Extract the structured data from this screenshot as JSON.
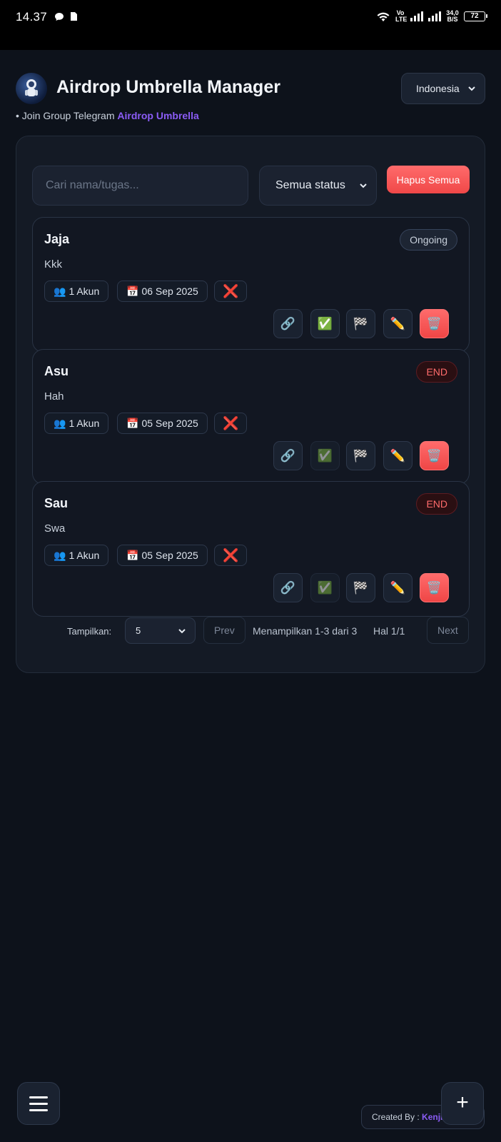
{
  "status_bar": {
    "time": "14.37",
    "volte": "Vo LTE",
    "speed": "34,0 B/S",
    "battery": "72"
  },
  "header": {
    "title": "Airdrop Umbrella Manager",
    "language": "Indonesia",
    "subline_prefix": "• Join Group Telegram ",
    "subline_link": "Airdrop Umbrella"
  },
  "toolbar": {
    "search_placeholder": "Cari nama/tugas...",
    "status_filter": "Semua status",
    "clear_all": "Hapus Semua"
  },
  "cards": [
    {
      "name": "Jaja",
      "desc": "Kkk",
      "status": "Ongoing",
      "accounts": "1 Akun",
      "date": "06 Sep 2025",
      "done": false
    },
    {
      "name": "Asu",
      "desc": "Hah",
      "status": "END",
      "accounts": "1 Akun",
      "date": "05 Sep 2025",
      "done": true
    },
    {
      "name": "Sau",
      "desc": "Swa",
      "status": "END",
      "accounts": "1 Akun",
      "date": "05 Sep 2025",
      "done": true
    }
  ],
  "icons": {
    "accounts": "👥",
    "date": "📅",
    "not_done": "❌",
    "link": "🔗",
    "check": "✅",
    "finish": "🏁",
    "edit": "✏️",
    "delete": "🗑️"
  },
  "pagination": {
    "show_label": "Tampilkan:",
    "page_size": "5",
    "prev": "Prev",
    "info": "Menampilkan 1-3 dari 3",
    "page": "Hal 1/1",
    "next": "Next"
  },
  "footer": {
    "credit_prefix": "Created By : ",
    "credit_name": "Kenji",
    "fab": "+"
  }
}
